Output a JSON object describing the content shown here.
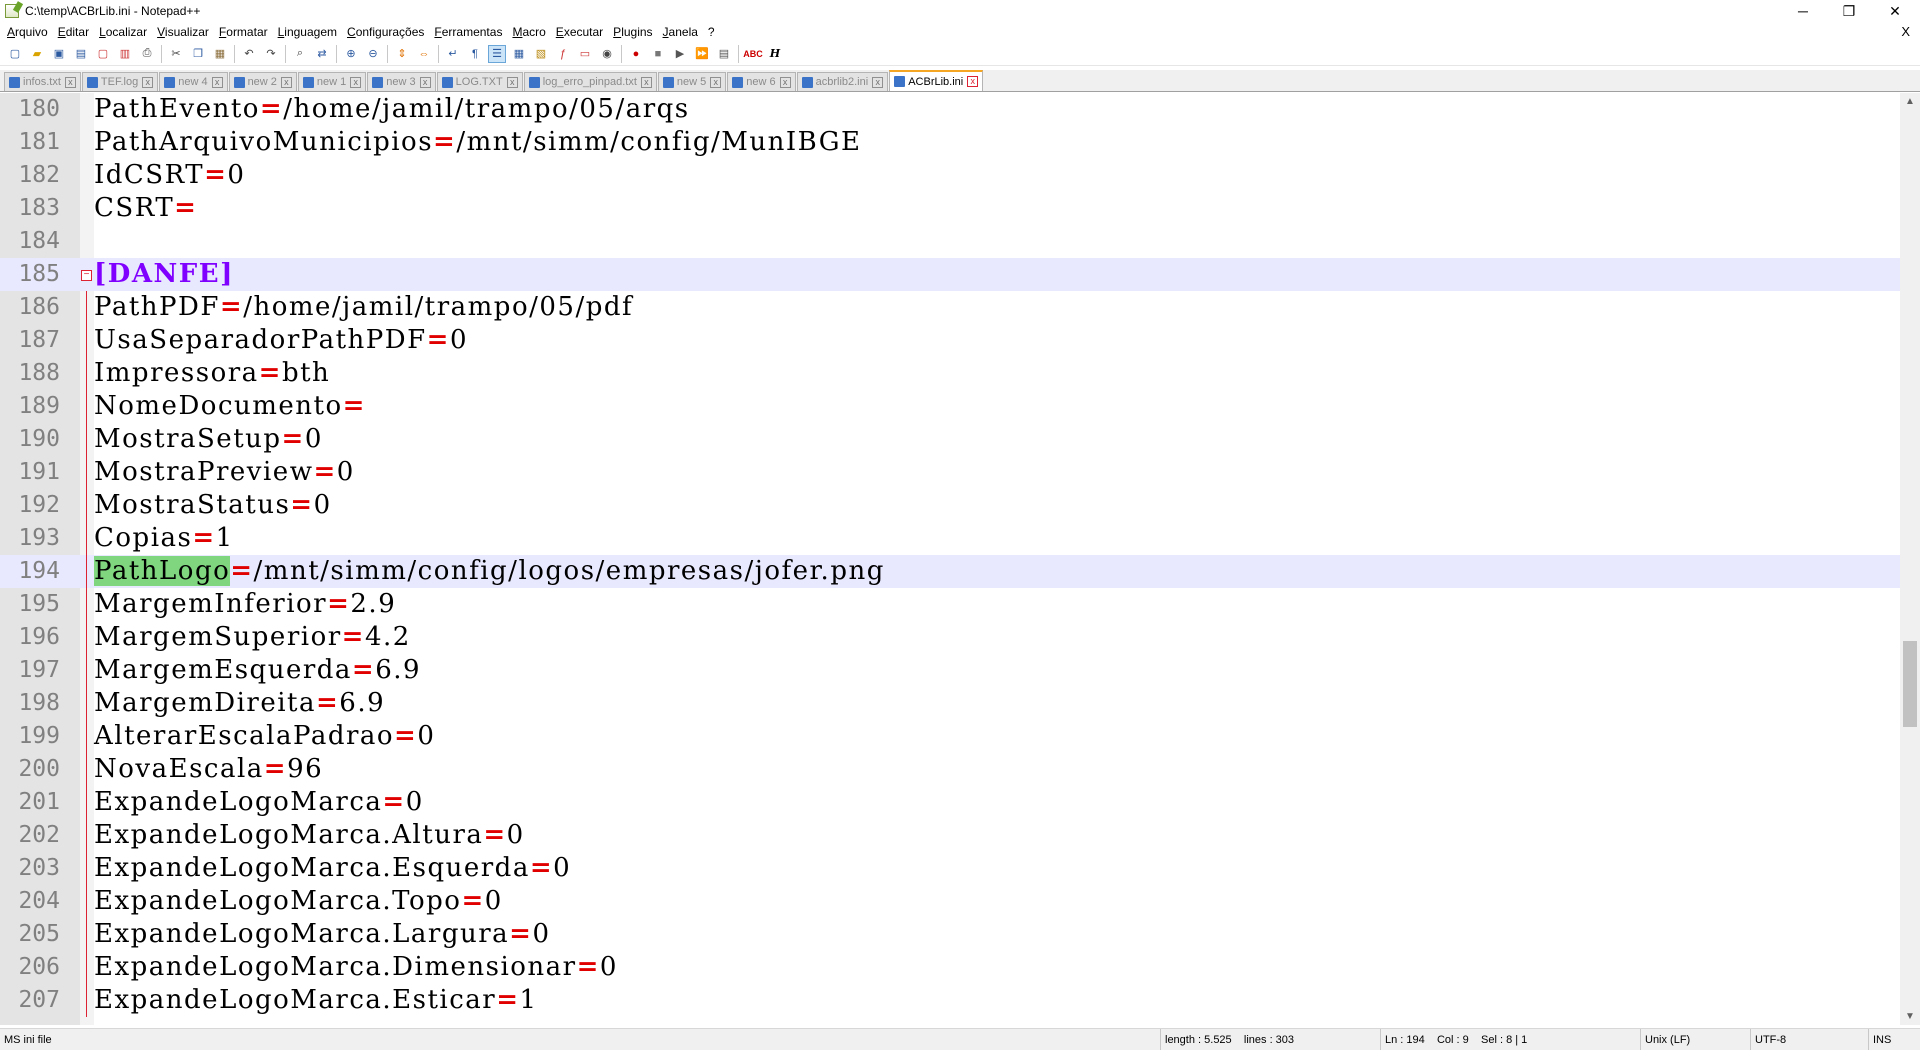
{
  "window": {
    "title": "C:\\temp\\ACBrLib.ini - Notepad++",
    "minimize": "─",
    "maximize": "❐",
    "close": "✕"
  },
  "menu": [
    "Arquivo",
    "Editar",
    "Localizar",
    "Visualizar",
    "Formatar",
    "Linguagem",
    "Configurações",
    "Ferramentas",
    "Macro",
    "Executar",
    "Plugins",
    "Janela",
    "?"
  ],
  "menu_close": "X",
  "tabs": [
    {
      "label": "infos.txt",
      "close": "x"
    },
    {
      "label": "TEF.log",
      "close": "x"
    },
    {
      "label": "new 4",
      "close": "x"
    },
    {
      "label": "new 2",
      "close": "x"
    },
    {
      "label": "new 1",
      "close": "x"
    },
    {
      "label": "new 3",
      "close": "x"
    },
    {
      "label": "LOG.TXT",
      "close": "x"
    },
    {
      "label": "log_erro_pinpad.txt",
      "close": "x"
    },
    {
      "label": "new 5",
      "close": "x"
    },
    {
      "label": "new 6",
      "close": "x"
    },
    {
      "label": "acbrlib2.ini",
      "close": "x"
    },
    {
      "label": "ACBrLib.ini",
      "close": "x",
      "active": true
    }
  ],
  "editor": {
    "lines": [
      {
        "n": "180",
        "key": "PathEvento",
        "eq": "=",
        "val": "/home/jamil/trampo/05/arqs"
      },
      {
        "n": "181",
        "key": "PathArquivoMunicipios",
        "eq": "=",
        "val": "/mnt/simm/config/MunIBGE"
      },
      {
        "n": "182",
        "key": "IdCSRT",
        "eq": "=",
        "val": "0"
      },
      {
        "n": "183",
        "key": "CSRT",
        "eq": "=",
        "val": ""
      },
      {
        "n": "184",
        "key": "",
        "eq": "",
        "val": ""
      },
      {
        "n": "185",
        "section": "[DANFE]"
      },
      {
        "n": "186",
        "key": "PathPDF",
        "eq": "=",
        "val": "/home/jamil/trampo/05/pdf"
      },
      {
        "n": "187",
        "key": "UsaSeparadorPathPDF",
        "eq": "=",
        "val": "0"
      },
      {
        "n": "188",
        "key": "Impressora",
        "eq": "=",
        "val": "bth"
      },
      {
        "n": "189",
        "key": "NomeDocumento",
        "eq": "=",
        "val": ""
      },
      {
        "n": "190",
        "key": "MostraSetup",
        "eq": "=",
        "val": "0"
      },
      {
        "n": "191",
        "key": "MostraPreview",
        "eq": "=",
        "val": "0"
      },
      {
        "n": "192",
        "key": "MostraStatus",
        "eq": "=",
        "val": "0"
      },
      {
        "n": "193",
        "key": "Copias",
        "eq": "=",
        "val": "1"
      },
      {
        "n": "194",
        "key": "PathLogo",
        "eq": "=",
        "val": "/mnt/simm/config/logos/empresas/jofer.png",
        "current": true
      },
      {
        "n": "195",
        "key": "MargemInferior",
        "eq": "=",
        "val": "2.9"
      },
      {
        "n": "196",
        "key": "MargemSuperior",
        "eq": "=",
        "val": "4.2"
      },
      {
        "n": "197",
        "key": "MargemEsquerda",
        "eq": "=",
        "val": "6.9"
      },
      {
        "n": "198",
        "key": "MargemDireita",
        "eq": "=",
        "val": "6.9"
      },
      {
        "n": "199",
        "key": "AlterarEscalaPadrao",
        "eq": "=",
        "val": "0"
      },
      {
        "n": "200",
        "key": "NovaEscala",
        "eq": "=",
        "val": "96"
      },
      {
        "n": "201",
        "key": "ExpandeLogoMarca",
        "eq": "=",
        "val": "0"
      },
      {
        "n": "202",
        "key": "ExpandeLogoMarca.Altura",
        "eq": "=",
        "val": "0"
      },
      {
        "n": "203",
        "key": "ExpandeLogoMarca.Esquerda",
        "eq": "=",
        "val": "0"
      },
      {
        "n": "204",
        "key": "ExpandeLogoMarca.Topo",
        "eq": "=",
        "val": "0"
      },
      {
        "n": "205",
        "key": "ExpandeLogoMarca.Largura",
        "eq": "=",
        "val": "0"
      },
      {
        "n": "206",
        "key": "ExpandeLogoMarca.Dimensionar",
        "eq": "=",
        "val": "0"
      },
      {
        "n": "207",
        "key": "ExpandeLogoMarca.Esticar",
        "eq": "=",
        "val": "1"
      }
    ]
  },
  "scroll": {
    "up": "▲",
    "down": "▼"
  },
  "status": {
    "type": "MS ini file",
    "length": "length : 5.525    lines : 303",
    "position": "Ln : 194    Col : 9    Sel : 8 | 1",
    "eol": "Unix (LF)",
    "encoding": "UTF-8",
    "mode": "INS"
  },
  "colors": {
    "equals": "#e00000",
    "section": "#8000ff",
    "current_line": "#e8e8ff",
    "selection_mark": "#7fd67f",
    "active_tab_accent": "#f5a623"
  },
  "toolbar_icons": [
    "new-file-icon",
    "open-icon",
    "save-icon",
    "save-all-icon",
    "close-icon",
    "close-all-icon",
    "print-icon",
    "cut-icon",
    "copy-icon",
    "paste-icon",
    "undo-icon",
    "redo-icon",
    "find-icon",
    "replace-icon",
    "zoom-in-icon",
    "zoom-out-icon",
    "sync-vertical-icon",
    "sync-horizontal-icon",
    "word-wrap-icon",
    "all-chars-icon",
    "indent-guide-icon",
    "lang-define-icon",
    "doc-map-icon",
    "function-list-icon",
    "folder-workspace-icon",
    "monitoring-icon",
    "record-macro-icon",
    "stop-macro-icon",
    "play-macro-icon",
    "run-macro-multiple-icon",
    "save-macro-icon",
    "spell-check-icon",
    "html-tag-icon"
  ]
}
